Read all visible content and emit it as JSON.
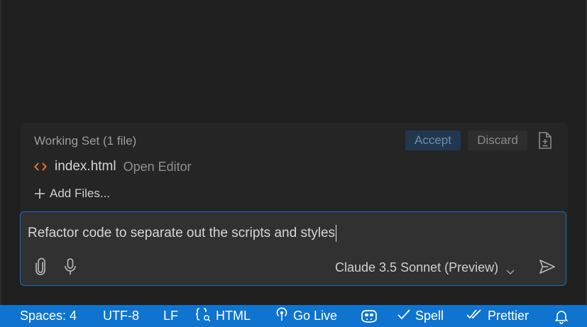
{
  "working_set": {
    "header": "Working Set (1 file)",
    "accept_label": "Accept",
    "discard_label": "Discard",
    "files": [
      {
        "name": "index.html",
        "action": "Open Editor",
        "icon": "code-icon"
      }
    ],
    "add_files_label": "Add Files..."
  },
  "chat": {
    "input_value": "Refactor code to separate out the scripts and styles",
    "model": "Claude 3.5 Sonnet (Preview)",
    "icons": [
      "paperclip-icon",
      "microphone-icon",
      "chevron-down-icon",
      "send-icon"
    ]
  },
  "status_bar": {
    "spaces": "Spaces: 4",
    "encoding": "UTF-8",
    "eol": "LF",
    "language": "HTML",
    "go_live": "Go Live",
    "spell": "Spell",
    "prettier": "Prettier"
  },
  "colors": {
    "background": "#1f1f1f",
    "panel": "#252526",
    "accent": "#0e74d0",
    "file_icon": "#e37933",
    "accept_bg": "#20374f"
  }
}
